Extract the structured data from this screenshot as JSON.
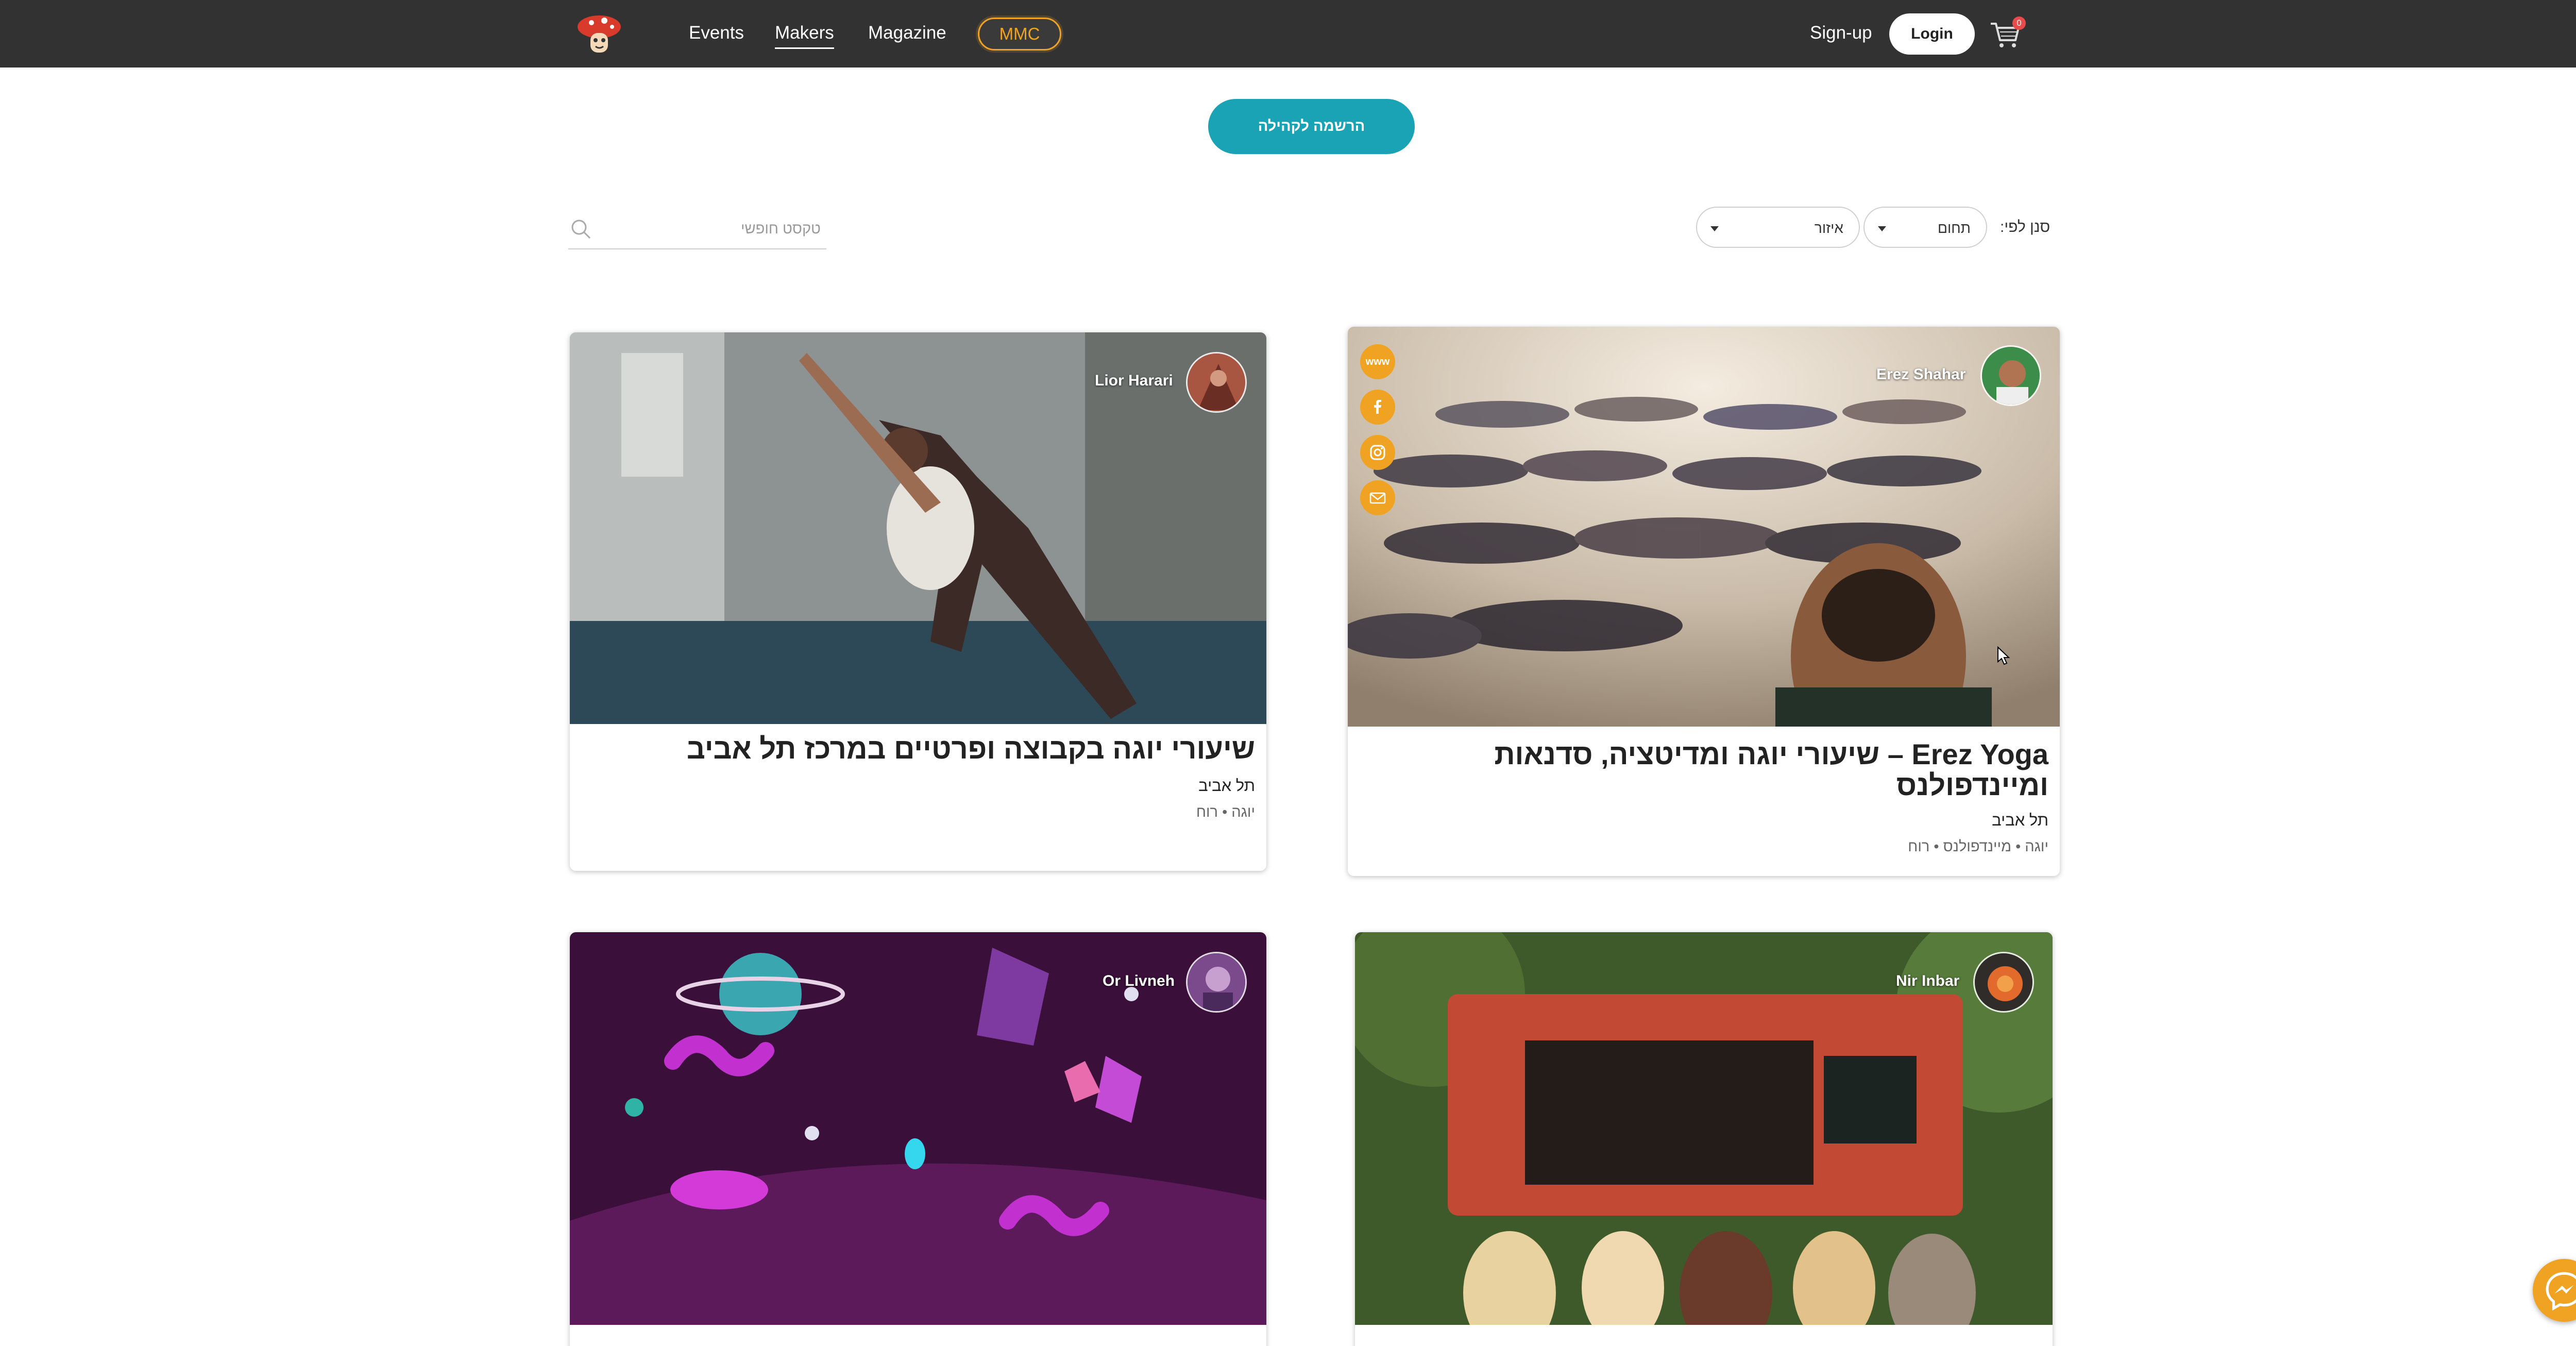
{
  "header": {
    "nav": [
      {
        "label": "Events",
        "active": false
      },
      {
        "label": "Makers",
        "active": true
      },
      {
        "label": "Magazine",
        "active": false
      }
    ],
    "mmc_label": "MMC",
    "signup_label": "Sign-up",
    "login_label": "Login",
    "cart_count": "0",
    "accent_color": "#f0a323",
    "bar_color": "#323232"
  },
  "join_button_label": "הרשמה לקהילה",
  "filters": {
    "label": "סנן לפי:",
    "field_select": "תחום",
    "area_select": "איזור",
    "search_placeholder": "טקסט חופשי"
  },
  "cards": [
    {
      "maker": "Erez Shahar",
      "title": "Erez Yoga – שיעורי יוגה ומדיטציה, סדנאות ומיינדפולנס",
      "city": "תל אביב",
      "tags": "יוגה • מיינדפולנס • רוח",
      "social": [
        "www",
        "facebook-icon",
        "instagram-icon",
        "mail-icon"
      ]
    },
    {
      "maker": "Lior Harari",
      "title": "שיעורי יוגה בקבוצה ופרטיים במרכז תל אביב",
      "city": "תל אביב",
      "tags": "יוגה • רוח"
    },
    {
      "maker": "Nir Inbar",
      "title": "",
      "city": "",
      "tags": ""
    },
    {
      "maker": "Or Livneh",
      "title": "",
      "city": "",
      "tags": ""
    }
  ]
}
